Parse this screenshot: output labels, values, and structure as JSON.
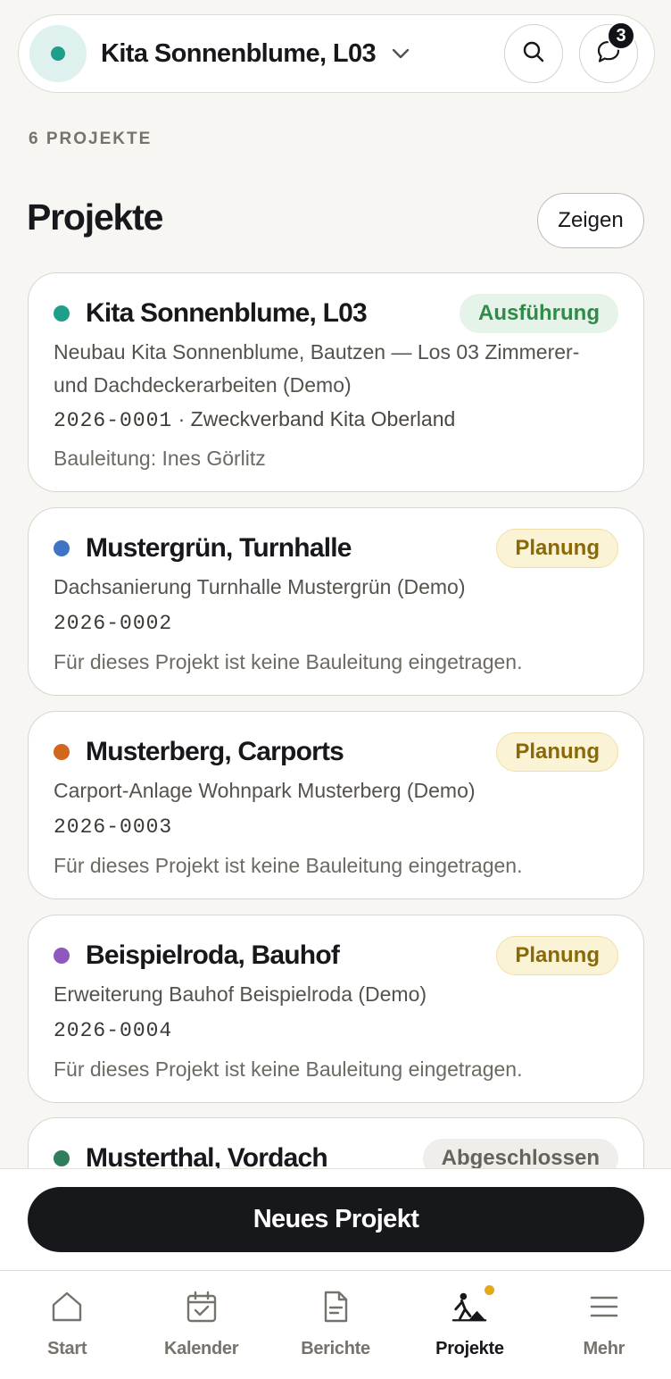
{
  "header": {
    "site_name": "Kita Sonnenblume, L03",
    "site_color": "#1f9e8a",
    "site_avatar_bg": "#dff1ef",
    "dropdown_icon": "chevron-down-icon",
    "search_icon": "search-icon",
    "chat_icon": "chat-bubble-icon",
    "notification_count": "3"
  },
  "list_header": {
    "count_label": "6 PROJEKTE",
    "title": "Projekte",
    "show_button": "Zeigen"
  },
  "projects": [
    {
      "name": "Kita Sonnenblume, L03",
      "color": "#1f9e8a",
      "status": "Ausführung",
      "status_fg": "#2f8b4a",
      "status_bg": "#e6f3e8",
      "status_border": "#e6f3e8",
      "description": "Neubau Kita Sonnenblume, Bautzen — Los 03 Zimmerer- und Dachdeckerarbeiten (Demo)",
      "number": "2026-0001",
      "client": "· Zweckverband Kita Oberland",
      "lead": "Bauleitung: Ines Görlitz"
    },
    {
      "name": "Mustergrün, Turnhalle",
      "color": "#3f73c4",
      "status": "Planung",
      "status_fg": "#8a6a08",
      "status_bg": "#fbf3d6",
      "status_border": "#efdfa5",
      "description": "Dachsanierung Turnhalle Mustergrün (Demo)",
      "number": "2026-0002",
      "client": "",
      "lead": "Für dieses Projekt ist keine Bauleitung eingetragen."
    },
    {
      "name": "Musterberg, Carports",
      "color": "#d0671d",
      "status": "Planung",
      "status_fg": "#8a6a08",
      "status_bg": "#fbf3d6",
      "status_border": "#efdfa5",
      "description": "Carport-Anlage Wohnpark Musterberg (Demo)",
      "number": "2026-0003",
      "client": "",
      "lead": "Für dieses Projekt ist keine Bauleitung eingetragen."
    },
    {
      "name": "Beispielroda, Bauhof",
      "color": "#8e58bf",
      "status": "Planung",
      "status_fg": "#8a6a08",
      "status_bg": "#fbf3d6",
      "status_border": "#efdfa5",
      "description": "Erweiterung Bauhof Beispielroda (Demo)",
      "number": "2026-0004",
      "client": "",
      "lead": "Für dieses Projekt ist keine Bauleitung eingetragen."
    },
    {
      "name": "Musterthal, Vordach",
      "color": "#2e7d5b",
      "status": "Abgeschlossen",
      "status_fg": "#66625c",
      "status_bg": "#efeeeb",
      "status_border": "#efeeeb",
      "description": "",
      "number": "",
      "client": "",
      "lead": ""
    }
  ],
  "primary_action": "Neues Projekt",
  "tabbar": {
    "tabs": [
      {
        "label": "Start",
        "icon": "home-icon",
        "active": false
      },
      {
        "label": "Kalender",
        "icon": "calendar-icon",
        "active": false
      },
      {
        "label": "Berichte",
        "icon": "document-icon",
        "active": false
      },
      {
        "label": "Projekte",
        "icon": "construction-worker-icon",
        "active": true,
        "indicator": true
      },
      {
        "label": "Mehr",
        "icon": "menu-icon",
        "active": false
      }
    ],
    "indicator_color": "#e6a817"
  }
}
